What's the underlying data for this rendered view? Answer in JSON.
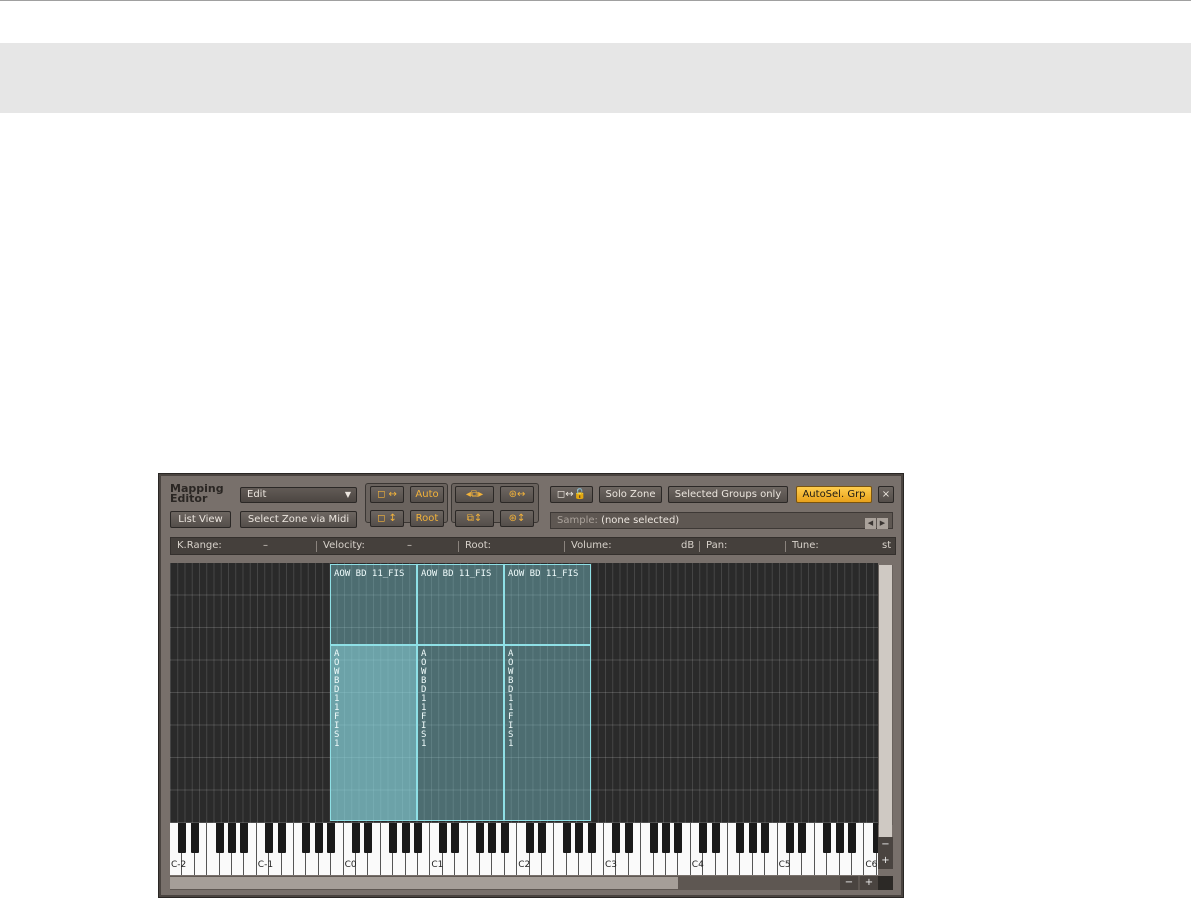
{
  "panel": {
    "title_line1": "Mapping",
    "title_line2": "Editor",
    "mode_dropdown": "Edit",
    "list_view": "List View",
    "select_zone_midi": "Select Zone via Midi",
    "auto": "Auto",
    "root": "Root",
    "solo_zone": "Solo Zone",
    "selected_groups_only": "Selected Groups only",
    "autosel_grp": "AutoSel. Grp",
    "close": "×",
    "sample_label": "Sample:",
    "sample_value": "(none selected)"
  },
  "infobar": {
    "krange_label": "K.Range:",
    "krange_value": "–",
    "velocity_label": "Velocity:",
    "velocity_value": "–",
    "root_label": "Root:",
    "volume_label": "Volume:",
    "volume_unit": "dB",
    "pan_label": "Pan:",
    "tune_label": "Tune:",
    "tune_unit": "st"
  },
  "zones": {
    "top_label_1": "AOW BD 11_FIS",
    "top_label_2": "AOW BD 11_FIS",
    "top_label_3": "AOW BD 11_FIS",
    "bottom_label_1": "AOW BD 11 FIS1",
    "bottom_label_2": "AOW BD 11 FIS1",
    "bottom_label_3": "AOW BD 11 FIS1"
  },
  "keyboard": {
    "octaves": [
      "C-2",
      "C-1",
      "C0",
      "C1",
      "C2",
      "C3",
      "C4",
      "C5",
      "C6"
    ]
  },
  "colors": {
    "accent": "#f2b23a",
    "active_button": "#ffcd4e",
    "zone_border": "#8fe0e6"
  }
}
